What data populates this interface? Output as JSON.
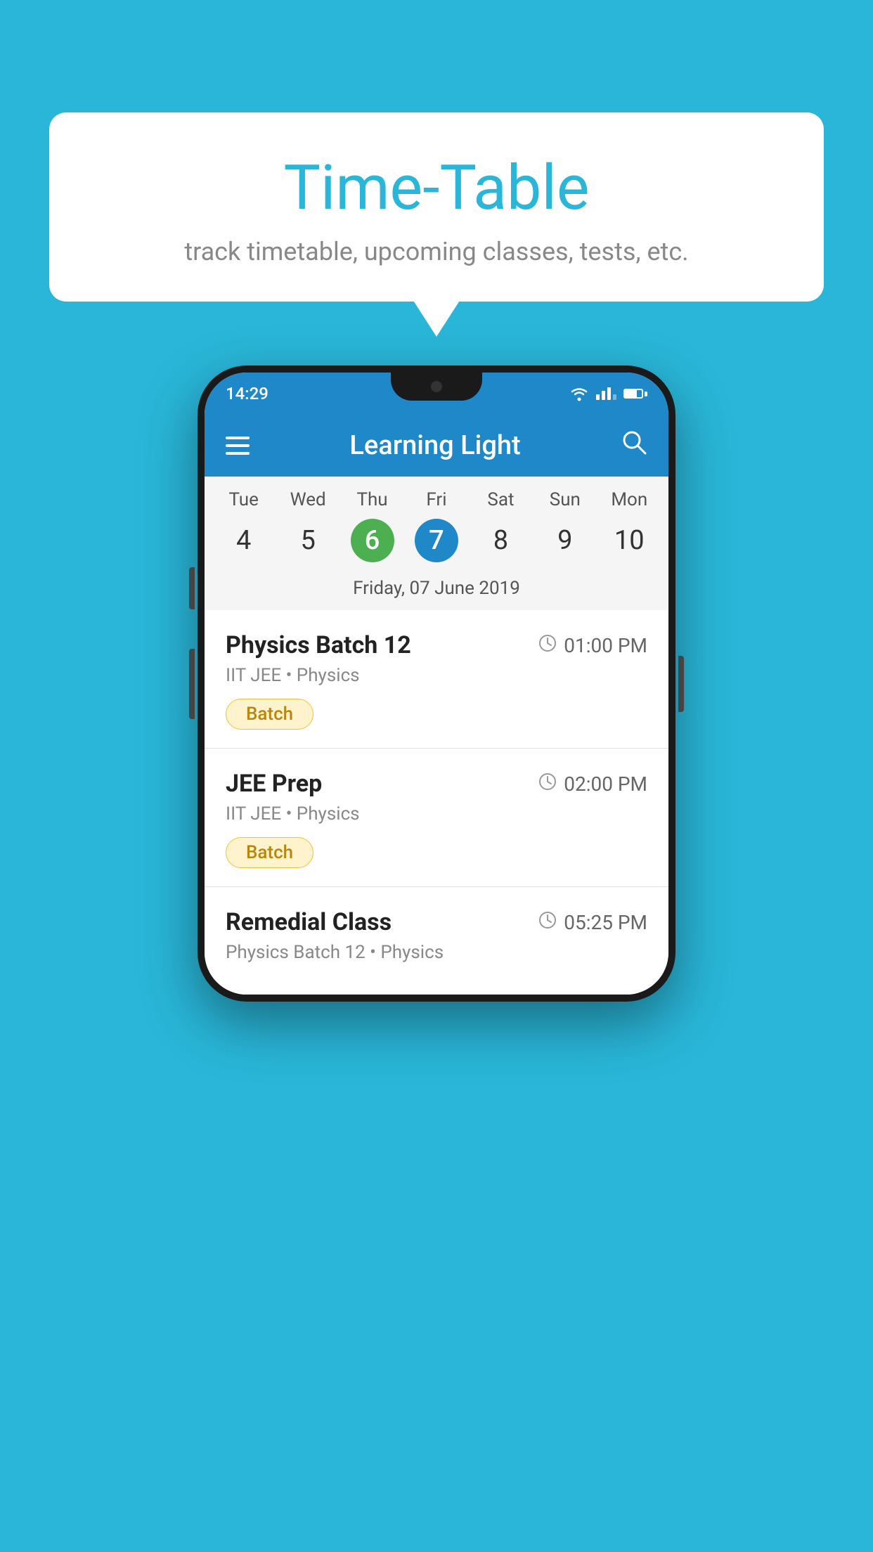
{
  "background_color": "#29b6d8",
  "bubble": {
    "title": "Time-Table",
    "subtitle": "track timetable, upcoming classes, tests, etc."
  },
  "phone": {
    "status_bar": {
      "time": "14:29"
    },
    "app_bar": {
      "title": "Learning Light"
    },
    "calendar": {
      "days": [
        {
          "label": "Tue",
          "num": "4",
          "state": "normal"
        },
        {
          "label": "Wed",
          "num": "5",
          "state": "normal"
        },
        {
          "label": "Thu",
          "num": "6",
          "state": "today"
        },
        {
          "label": "Fri",
          "num": "7",
          "state": "selected"
        },
        {
          "label": "Sat",
          "num": "8",
          "state": "normal"
        },
        {
          "label": "Sun",
          "num": "9",
          "state": "normal"
        },
        {
          "label": "Mon",
          "num": "10",
          "state": "normal"
        }
      ],
      "selected_date": "Friday, 07 June 2019"
    },
    "schedule": [
      {
        "title": "Physics Batch 12",
        "time": "01:00 PM",
        "subtitle": "IIT JEE • Physics",
        "badge": "Batch"
      },
      {
        "title": "JEE Prep",
        "time": "02:00 PM",
        "subtitle": "IIT JEE • Physics",
        "badge": "Batch"
      },
      {
        "title": "Remedial Class",
        "time": "05:25 PM",
        "subtitle": "Physics Batch 12 • Physics",
        "badge": null
      }
    ]
  }
}
